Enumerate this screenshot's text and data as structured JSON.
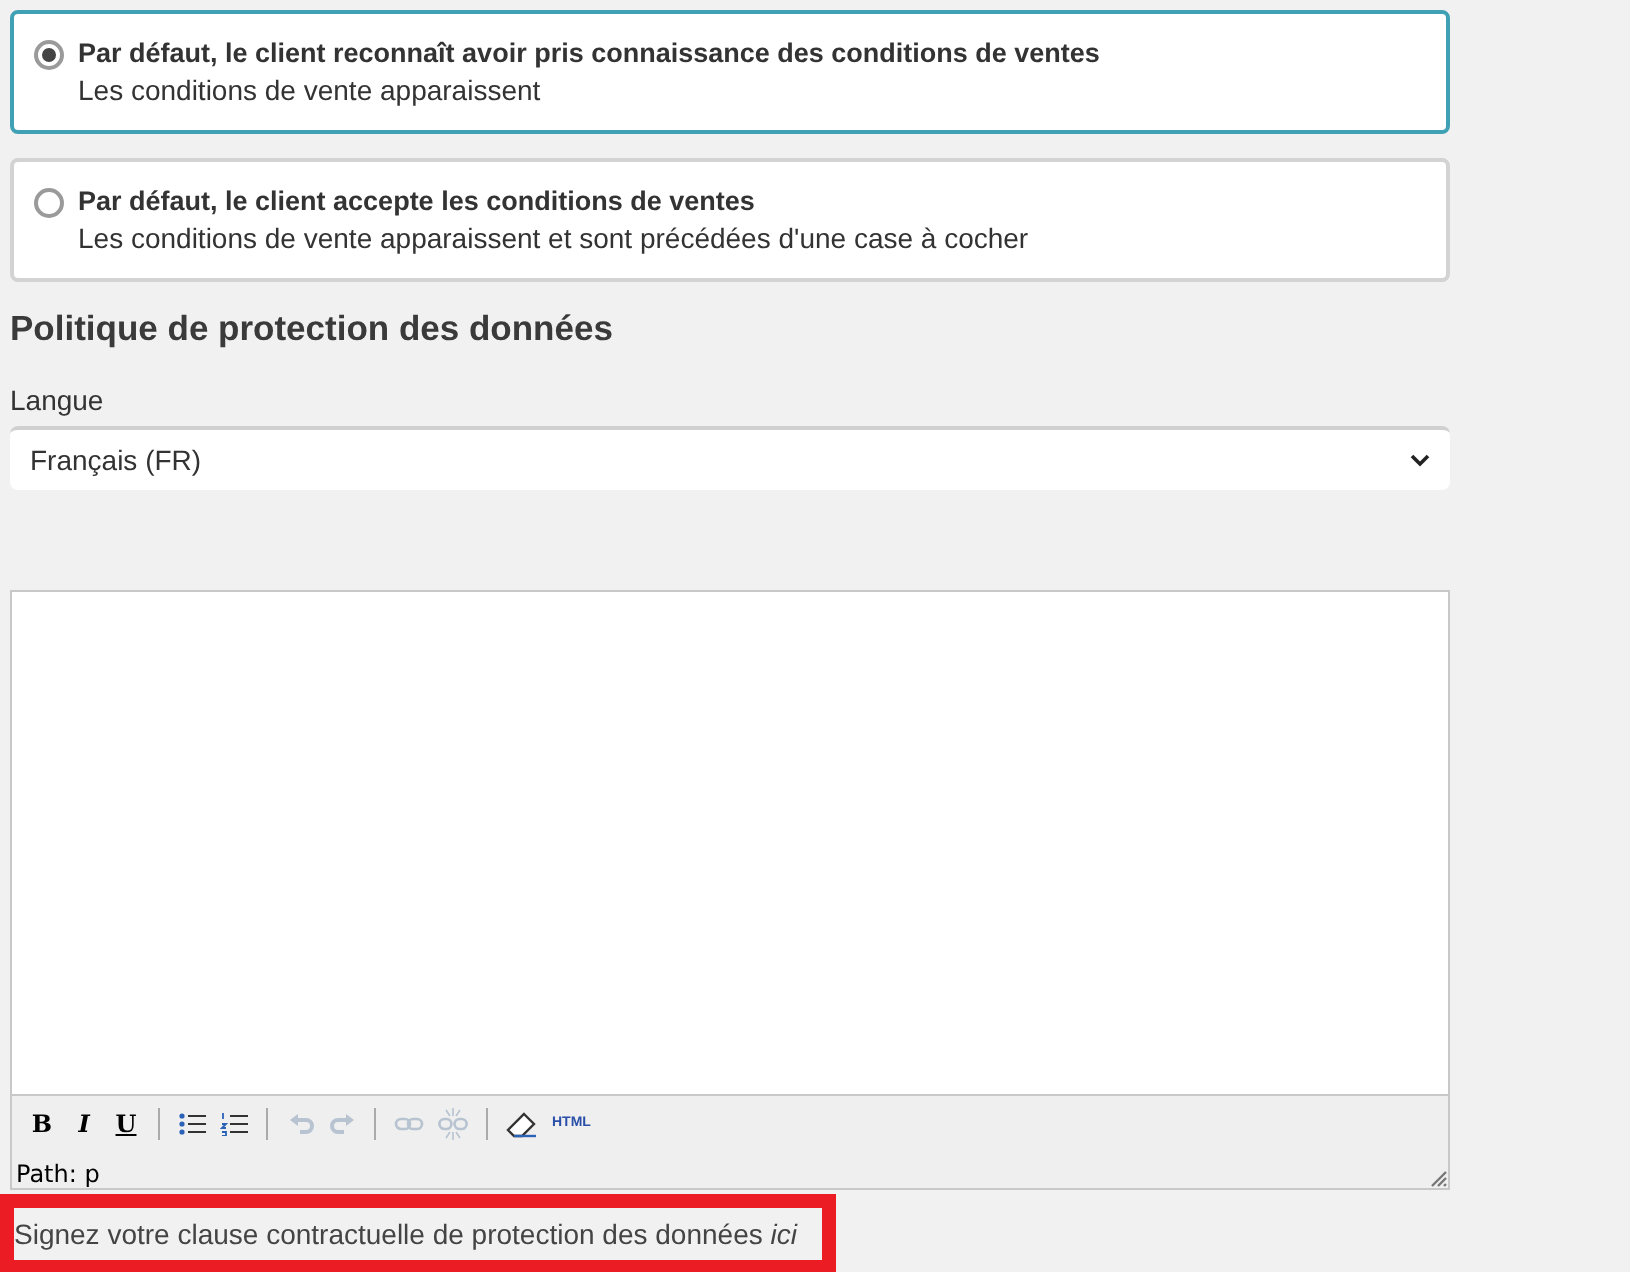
{
  "options": [
    {
      "title": "Par défaut, le client reconnaît avoir pris connaissance des conditions de ventes",
      "description": "Les conditions de vente apparaissent",
      "selected": true
    },
    {
      "title": "Par défaut, le client accepte les conditions de ventes",
      "description": "Les conditions de vente apparaissent et sont précédées d'une case à cocher",
      "selected": false
    }
  ],
  "section_title": "Politique de protection des données",
  "language": {
    "label": "Langue",
    "value": "Français (FR)"
  },
  "editor": {
    "toolbar": [
      {
        "kind": "bold",
        "label": "B",
        "disabled": false
      },
      {
        "kind": "italic",
        "label": "I",
        "disabled": false
      },
      {
        "kind": "underline",
        "label": "U",
        "disabled": false
      },
      {
        "kind": "separator"
      },
      {
        "kind": "bullets",
        "disabled": false
      },
      {
        "kind": "numbers",
        "disabled": false
      },
      {
        "kind": "separator"
      },
      {
        "kind": "undo",
        "disabled": true
      },
      {
        "kind": "redo",
        "disabled": true
      },
      {
        "kind": "separator"
      },
      {
        "kind": "link",
        "disabled": true
      },
      {
        "kind": "unlink",
        "disabled": true
      },
      {
        "kind": "separator"
      },
      {
        "kind": "eraser",
        "disabled": false
      },
      {
        "kind": "html",
        "label": "HTML",
        "disabled": false
      }
    ],
    "path": "Path: p"
  },
  "footer": {
    "text": "Signez votre clause contractuelle de protection des données",
    "link": "ici",
    "highlighted": true
  }
}
